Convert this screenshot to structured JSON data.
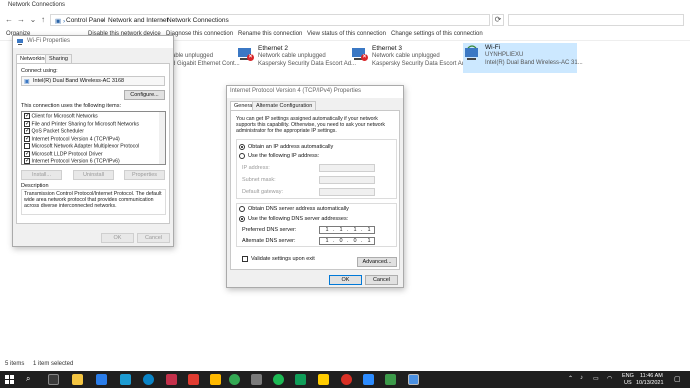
{
  "window": {
    "title": "Network Connections",
    "path": [
      "Control Panel",
      "Network and Internet",
      "Network Connections"
    ],
    "commands": [
      "Organize",
      "Disable this network device",
      "Diagnose this connection",
      "Rename this connection",
      "View status of this connection",
      "Change settings of this connection"
    ]
  },
  "adapters": [
    {
      "name": "",
      "status": "able unplugged",
      "device": "d Gigabit Ethernet Cont..."
    },
    {
      "name": "Ethernet 2",
      "status": "Network cable unplugged",
      "device": "Kaspersky Security Data Escort Ad..."
    },
    {
      "name": "Ethernet 3",
      "status": "Network cable unplugged",
      "device": "Kaspersky Security Data Escort Ad..."
    },
    {
      "name": "Wi-Fi",
      "status": "UYNHPLIEXU",
      "device": "Intel(R) Dual Band Wireless-AC 31..."
    }
  ],
  "statusbar": {
    "items": "5 items",
    "selected": "1 item selected"
  },
  "wifi_props": {
    "title": "Wi-Fi Properties",
    "tabs": [
      "Networking",
      "Sharing"
    ],
    "connect_using_label": "Connect using:",
    "adapter": "Intel(R) Dual Band Wireless-AC 3168",
    "configure": "Configure...",
    "items_label": "This connection uses the following items:",
    "items": [
      "Client for Microsoft Networks",
      "File and Printer Sharing for Microsoft Networks",
      "QoS Packet Scheduler",
      "Internet Protocol Version 4 (TCP/IPv4)",
      "Microsoft Network Adapter Multiplexor Protocol",
      "Microsoft LLDP Protocol Driver",
      "Internet Protocol Version 6 (TCP/IPv6)"
    ],
    "install": "Install...",
    "uninstall": "Uninstall",
    "properties": "Properties",
    "description_label": "Description",
    "description": "Transmission Control Protocol/Internet Protocol. The default wide area network protocol that provides communication across diverse interconnected networks.",
    "ok": "OK",
    "cancel": "Cancel"
  },
  "ipv4": {
    "title": "Internet Protocol Version 4 (TCP/IPv4) Properties",
    "tabs": [
      "General",
      "Alternate Configuration"
    ],
    "intro": "You can get IP settings assigned automatically if your network supports this capability. Otherwise, you need to ask your network administrator for the appropriate IP settings.",
    "obtain_ip": "Obtain an IP address automatically",
    "use_ip": "Use the following IP address:",
    "ip_label": "IP address:",
    "subnet_label": "Subnet mask:",
    "gateway_label": "Default gateway:",
    "obtain_dns": "Obtain DNS server address automatically",
    "use_dns": "Use the following DNS server addresses:",
    "pref_dns_label": "Preferred DNS server:",
    "alt_dns_label": "Alternate DNS server:",
    "pref_dns": [
      "1",
      "1",
      "1",
      "1"
    ],
    "alt_dns": [
      "1",
      "0",
      "0",
      "1"
    ],
    "validate": "Validate settings upon exit",
    "advanced": "Advanced...",
    "ok": "OK",
    "cancel": "Cancel"
  },
  "taskbar": {
    "lang1": "ENG",
    "lang2": "US",
    "time": "11:46 AM",
    "date": "10/13/2021"
  }
}
